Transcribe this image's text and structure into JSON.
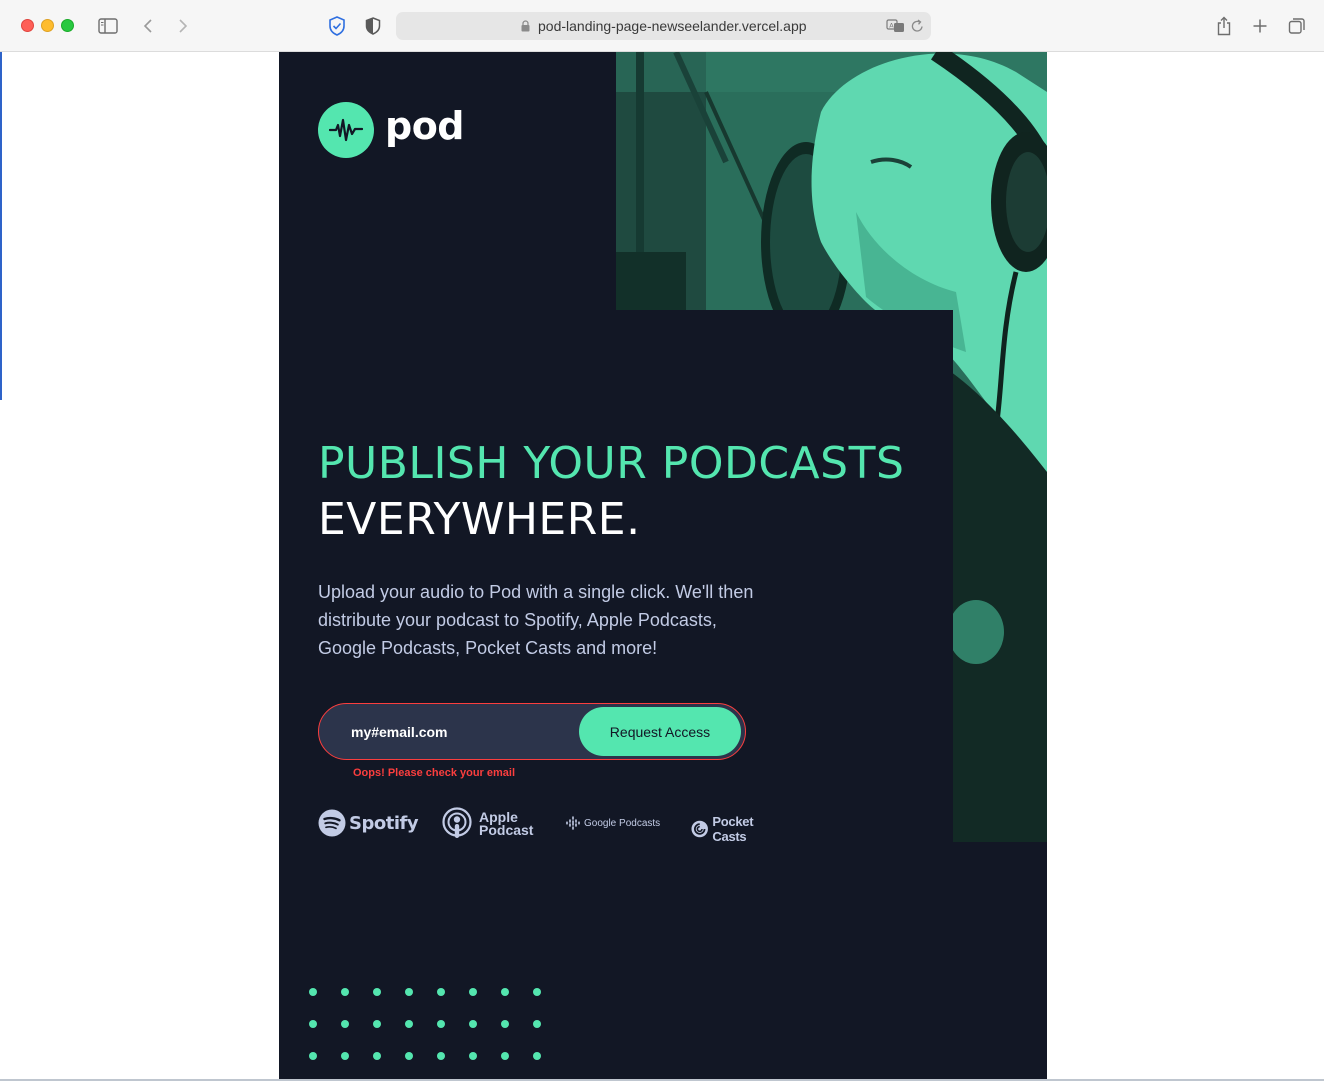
{
  "browser": {
    "url": "pod-landing-page-newseelander.vercel.app"
  },
  "brand": {
    "name": "pod",
    "accent_color": "#54e6af",
    "background_color": "#121725",
    "error_color": "#fb3e3e"
  },
  "hero": {
    "headline_accent": "PUBLISH YOUR PODCASTS",
    "headline_plain": "EVERYWHERE.",
    "intro": "Upload your audio to Pod with a single click. We'll then distribute your podcast to Spotify, Apple Podcasts, Google Podcasts, Pocket Casts and more!"
  },
  "form": {
    "email_value": "my#email.com",
    "submit_label": "Request Access",
    "error_message": "Oops! Please check your email"
  },
  "platforms": {
    "spotify": "Spotify",
    "apple_line1": "Apple",
    "apple_line2": "Podcast",
    "google": "Google Podcasts",
    "pocket": "Pocket Casts"
  }
}
